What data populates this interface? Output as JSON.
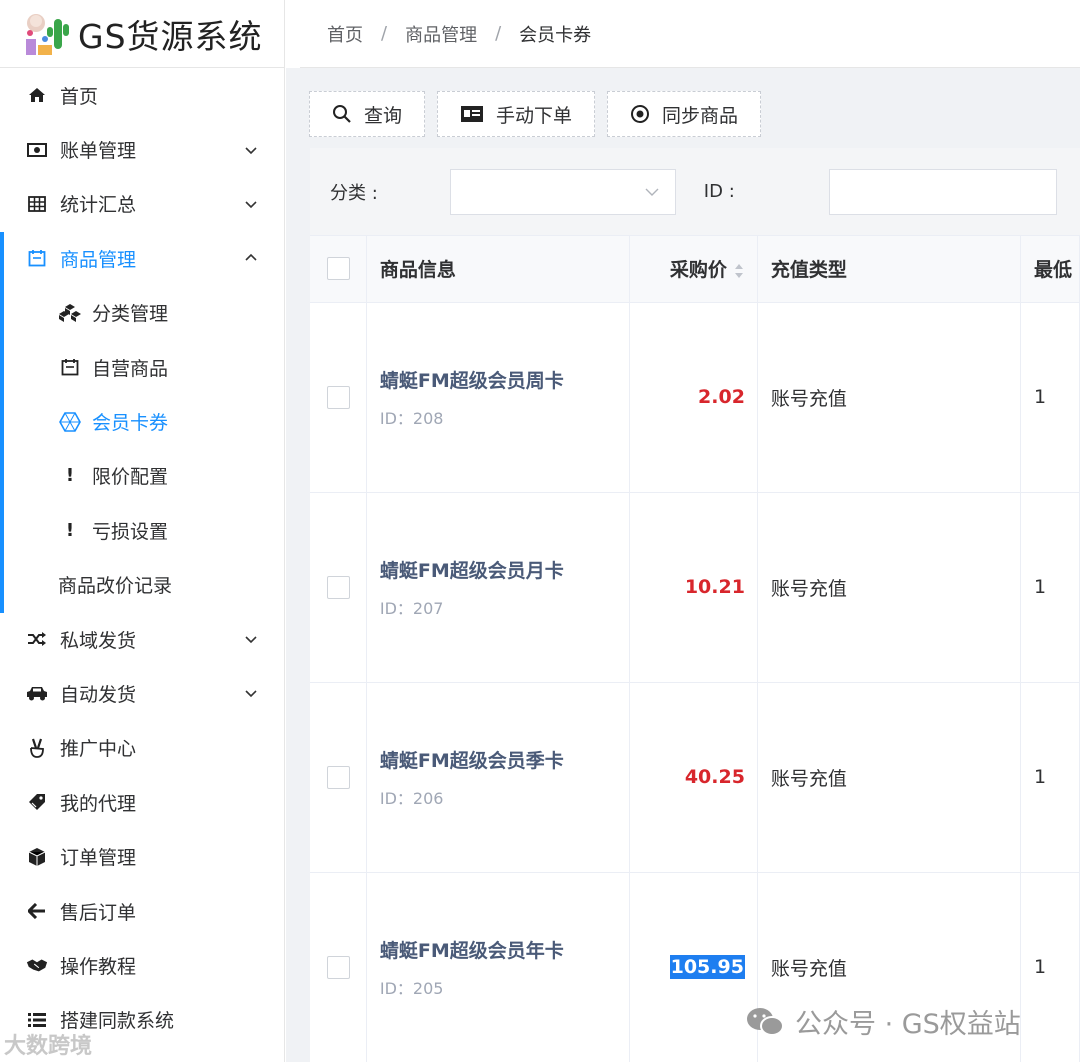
{
  "app": {
    "title": "GS货源系统"
  },
  "breadcrumb": [
    "首页",
    "商品管理",
    "会员卡券"
  ],
  "breadcrumb_sep": "/",
  "sidebar": {
    "items": [
      {
        "label": "首页",
        "icon": "home-icon"
      },
      {
        "label": "账单管理",
        "icon": "bill-icon",
        "expandable": true
      },
      {
        "label": "统计汇总",
        "icon": "table-icon",
        "expandable": true
      },
      {
        "label": "商品管理",
        "icon": "calendar-icon",
        "expandable": true,
        "expanded": true,
        "children": [
          {
            "label": "分类管理",
            "icon": "cubes-icon"
          },
          {
            "label": "自营商品",
            "icon": "calendar-icon"
          },
          {
            "label": "会员卡券",
            "icon": "hexagon-icon",
            "active": true
          },
          {
            "label": "限价配置",
            "icon": "exclamation-icon"
          },
          {
            "label": "亏损设置",
            "icon": "exclamation-icon"
          },
          {
            "label": "商品改价记录",
            "icon": ""
          }
        ]
      },
      {
        "label": "私域发货",
        "icon": "shuffle-icon",
        "expandable": true
      },
      {
        "label": "自动发货",
        "icon": "car-icon",
        "expandable": true
      },
      {
        "label": "推广中心",
        "icon": "peace-hand-icon"
      },
      {
        "label": "我的代理",
        "icon": "tag-icon"
      },
      {
        "label": "订单管理",
        "icon": "cube-icon"
      },
      {
        "label": "售后订单",
        "icon": "arrow-left-icon"
      },
      {
        "label": "操作教程",
        "icon": "handshake-icon"
      },
      {
        "label": "搭建同款系统",
        "icon": "list-icon"
      }
    ]
  },
  "toolbar": {
    "query_label": "查询",
    "manual_order_label": "手动下单",
    "sync_label": "同步商品"
  },
  "filter": {
    "category_label": "分类 :",
    "category_value": "",
    "id_label": "ID :",
    "id_value": ""
  },
  "table": {
    "headers": [
      "商品信息",
      "采购价",
      "充值类型",
      "最低"
    ],
    "rows": [
      {
        "name": "蜻蜓FM超级会员周卡",
        "id": "ID：208",
        "price": "2.02",
        "type": "账号充值",
        "min": "1",
        "price_selected": false
      },
      {
        "name": "蜻蜓FM超级会员月卡",
        "id": "ID：207",
        "price": "10.21",
        "type": "账号充值",
        "min": "1",
        "price_selected": false
      },
      {
        "name": "蜻蜓FM超级会员季卡",
        "id": "ID：206",
        "price": "40.25",
        "type": "账号充值",
        "min": "1",
        "price_selected": false
      },
      {
        "name": "蜻蜓FM超级会员年卡",
        "id": "ID：205",
        "price": "105.95",
        "type": "账号充值",
        "min": "1",
        "price_selected": true
      }
    ]
  },
  "watermark": {
    "text": "公众号 · GS权益站",
    "text2": "大数跨境"
  },
  "colors": {
    "accent": "#1890ff",
    "price": "#d8262c",
    "product_name": "#4a5a78"
  }
}
